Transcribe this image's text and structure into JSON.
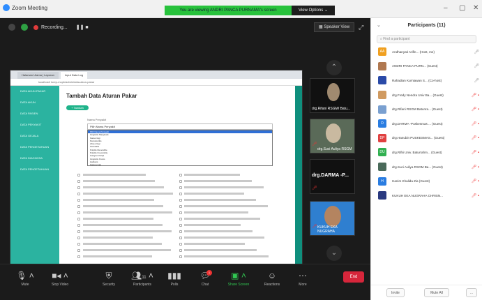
{
  "window": {
    "title": "Zoom Meeting",
    "viewing_banner": "You are viewing ANDRI PANCA PURNAMA's screen",
    "view_options": "View Options ⌄"
  },
  "topbar": {
    "recording_label": "Recording...",
    "speaker_view": "Speaker View"
  },
  "shared_screen": {
    "browser_tab1": "Halaman Utama | Laporan",
    "browser_tab2": "Input Data Log",
    "address": "localhost/ lorep-mcpb/admin/data-akun-pakar",
    "sidebar_items": [
      "DATA AKUN PAKAR",
      "DATA AKUN",
      "DATA PASIEN",
      "DATA PENYAKIT",
      "DATA GEJALA",
      "DATA PENGETAHUAN",
      "DATA DIAGNOSA",
      "DATA PENGETAHUAN"
    ],
    "heading": "Tambah Data Aturan Pakar",
    "add_button": "+ Tambah",
    "field_label": "Nama Penyakit",
    "select_value": "Pilih Nama Penyakit",
    "dropdown_options": [
      "Pilih Nama Penyakit",
      "Gingivitis Marginalis",
      "Karies Gigi",
      "Periodontitis",
      "Abses Gigi",
      "Stomatitis",
      "Pulpitis Reversible",
      "Pulpitis Irreversible",
      "Gangren Pulpa",
      "Gingivitis Kronis",
      "Halitosis",
      "Karang Gigi"
    ]
  },
  "thumbnails": [
    {
      "name": "drg.Rifani RSGM/ Batu...",
      "muted": true
    },
    {
      "name": "drg.Suci Auliya RSGM",
      "muted": true
    },
    {
      "name": "drg.DARMA -P...",
      "muted": true
    },
    {
      "name": "KUKUH EKA NUGRAHA",
      "muted": true
    }
  ],
  "toolbar": [
    {
      "label": "Mute",
      "icon": "microphone-icon"
    },
    {
      "label": "Stop Video",
      "icon": "video-camera-icon"
    },
    {
      "label": "Security",
      "icon": "shield-icon"
    },
    {
      "label": "Participants",
      "icon": "people-icon",
      "count": "11"
    },
    {
      "label": "Polls",
      "icon": "poll-icon"
    },
    {
      "label": "Chat",
      "icon": "chat-bubble-icon",
      "badge": "1"
    },
    {
      "label": "Share Screen",
      "icon": "share-screen-icon"
    },
    {
      "label": "Reactions",
      "icon": "reaction-icon"
    },
    {
      "label": "More",
      "icon": "more-dots-icon"
    }
  ],
  "end_label": "End",
  "participants_panel": {
    "title": "Participants (11)",
    "search_placeholder": "Find a participant",
    "participants": [
      {
        "initials": "AA",
        "color": "#f0a020",
        "name": "Andhanyati Arifin... (Host, me)"
      },
      {
        "initials": "",
        "color": "#b07850",
        "name": "ANDRI PANCA PURN... (Guest)"
      },
      {
        "initials": "",
        "color": "#2a4aa8",
        "name": "Rahadian Kurniawan S... (Co-host)"
      },
      {
        "initials": "",
        "color": "#d09a60",
        "name": "drg.Fredy Nendra Univ Ba... (Guest)"
      },
      {
        "initials": "",
        "color": "#7aa0d0",
        "name": "drg.Rifani RSGM Batunra... (Guest)"
      },
      {
        "initials": "D",
        "color": "#2a7de1",
        "name": "drg.DARMA -Puskesmas ... (Guest)"
      },
      {
        "initials": "DP",
        "color": "#e04040",
        "name": "drg.Hanubin PUSKESMAS... (Guest)"
      },
      {
        "initials": "DU",
        "color": "#30b050",
        "name": "drg.Rifki Univ. Baturrahm... (Guest)"
      },
      {
        "initials": "",
        "color": "#4a6a5a",
        "name": "drg.Suci Auliya RSGM Ba... (Guest)"
      },
      {
        "initials": "H",
        "color": "#2a7de1",
        "name": "Hanim Khalida Zia (Guest)"
      },
      {
        "initials": "",
        "color": "#2a3a80",
        "name": "KUKUH EKA NUGRAHA CHRISN..."
      }
    ],
    "invite_label": "Invite",
    "mute_all_label": "Mute All",
    "more_label": "..."
  }
}
